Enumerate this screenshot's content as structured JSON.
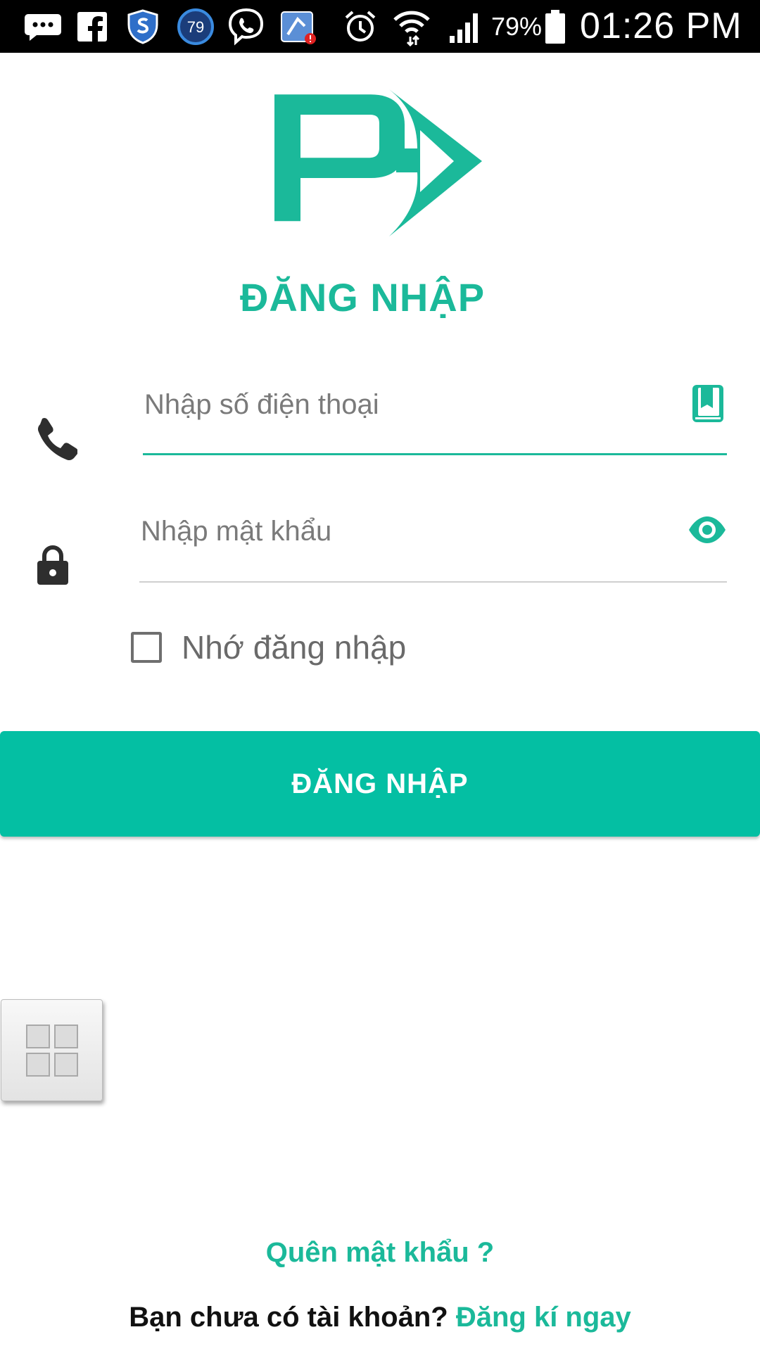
{
  "status_bar": {
    "battery_percent": "79%",
    "time": "01:26 PM",
    "icons": [
      "messaging-icon",
      "facebook-icon",
      "shield-icon",
      "badge-79-icon",
      "viber-icon",
      "app-notification-icon",
      "alarm-icon",
      "wifi-icon",
      "signal-icon",
      "battery-icon"
    ],
    "badge_text": "79"
  },
  "header": {
    "title": "ĐĂNG NHẬP",
    "brand_color": "#1bb99a"
  },
  "form": {
    "phone_placeholder": "Nhập số điện thoại",
    "phone_value": "",
    "password_placeholder": "Nhập mật khẩu",
    "password_value": "",
    "remember_label": "Nhớ đăng nhập",
    "remember_checked": false
  },
  "login_button": {
    "label": "ĐĂNG NHẬP",
    "color": "#04bfa3"
  },
  "footer": {
    "forgot_password": "Quên mật khẩu ?",
    "no_account": "Bạn chưa có tài khoản?",
    "signup_link": "Đăng kí ngay"
  }
}
